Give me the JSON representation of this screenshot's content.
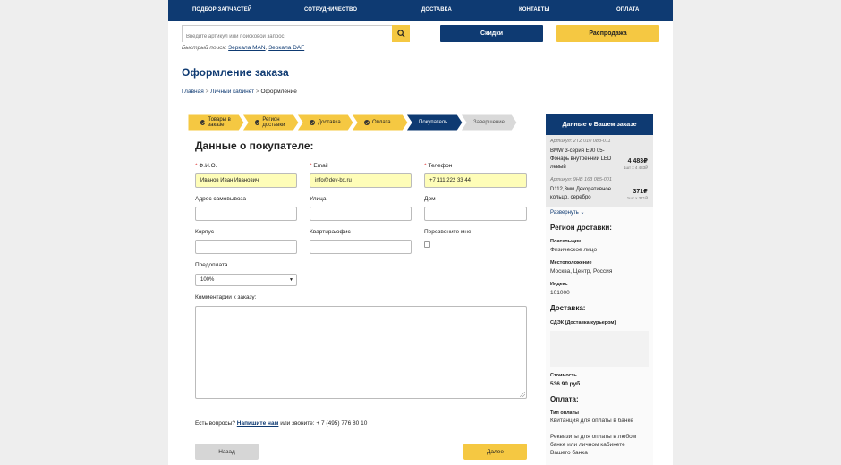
{
  "nav": {
    "items": [
      "Подбор запчастей",
      "Сотрудничество",
      "Доставка",
      "Контакты",
      "Оплата"
    ]
  },
  "search": {
    "placeholder": "Введите артикул или поисковой запрос",
    "icon": "search-icon"
  },
  "header_buttons": {
    "discounts": "Скидки",
    "sale": "Распродажа"
  },
  "quick_search": {
    "label": "Быстрый поиск:",
    "link1": "Зеркала MAN",
    "link2": "Зеркала DAF"
  },
  "page_title": "Оформление заказа",
  "breadcrumb": {
    "home": "Главная",
    "cabinet": "Личный кабинет",
    "current": "Оформление",
    "sep": ">"
  },
  "steps": [
    {
      "label": "Товары в заказе",
      "state": "done"
    },
    {
      "label": "Регион доставки",
      "state": "done"
    },
    {
      "label": "Доставка",
      "state": "done"
    },
    {
      "label": "Оплата",
      "state": "done"
    },
    {
      "label": "Покупатель",
      "state": "active"
    },
    {
      "label": "Завершение",
      "state": "pending"
    }
  ],
  "form": {
    "title": "Данные о покупателе:",
    "fio_label": "Ф.И.О.",
    "fio_value": "Иванов Иван Иванович",
    "email_label": "Email",
    "email_value": "info@dev-bx.ru",
    "phone_label": "Телефон",
    "phone_value": "+7 111 222 33 44",
    "pickup_label": "Адрес самовывоза",
    "street_label": "Улица",
    "house_label": "Дом",
    "building_label": "Корпус",
    "apt_label": "Квартира/офис",
    "callback_label": "Перезвоните мне",
    "prepay_label": "Предоплата",
    "prepay_value": "100%",
    "comment_label": "Комментарии к заказу:",
    "required_mark": "*"
  },
  "help": {
    "prefix": "Есть вопросы?",
    "link": "Напишите нам",
    "suffix": "или звоните: + 7 (495) 776 80 10"
  },
  "buttons": {
    "back": "Назад",
    "next": "Далее"
  },
  "sidebar": {
    "title": "Данные о Вашем заказе",
    "items": [
      {
        "article": "Артикул: 2TZ 010 083-011",
        "name1": "BMW 3-серия E90 05-",
        "name2": "Фонарь внутренний LED",
        "name3": "левый",
        "price": "4 483₽",
        "unit": "1шт x 4 483₽"
      },
      {
        "article": "Артикул: 9HB 163 085-001",
        "name1": "D112,3мм Декоративное",
        "name2": "кольцо, серебро",
        "price": "371₽",
        "unit": "1шт x 371₽"
      }
    ],
    "expand": "Развернуть",
    "region_title": "Регион доставки:",
    "payer_label": "Плательщик",
    "payer_value": "Физическое лицо",
    "location_label": "Местоположение",
    "location_value": "Москва, Центр, Россия",
    "index_label": "Индекс",
    "index_value": "101000",
    "delivery_title": "Доставка:",
    "delivery_name": "СДЭК (Доставка курьером)",
    "cost_label": "Стоимость",
    "cost_value": "536.90 руб.",
    "payment_title": "Оплата:",
    "paytype_label": "Тип оплаты",
    "paytype_value": "Квитанция для оплаты в банке",
    "pay_note1": "Реквизиты для оплаты в любом",
    "pay_note2": "банке или личном кабинете",
    "pay_note3": "Вашего банка"
  },
  "colors": {
    "brand": "#0e3a72",
    "accent": "#f5c842",
    "filled": "#fefdb8"
  }
}
